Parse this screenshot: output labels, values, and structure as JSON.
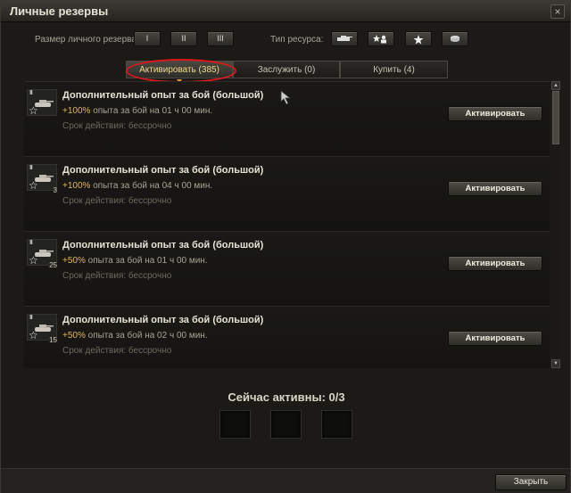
{
  "window": {
    "title": "Личные резервы"
  },
  "filters": {
    "size_label": "Размер личного резерва:",
    "size_buttons": [
      "I",
      "II",
      "III"
    ],
    "type_label": "Тип ресурса:",
    "type_buttons": [
      "tank-xp-icon",
      "crew-xp-icon",
      "free-xp-star-icon",
      "credits-icon"
    ]
  },
  "tabs": [
    {
      "label": "Активировать (385)",
      "active": true
    },
    {
      "label": "Заслужить (0)",
      "active": false
    },
    {
      "label": "Купить (4)",
      "active": false
    }
  ],
  "items": [
    {
      "tier": "III",
      "count": "",
      "name": "Дополнительный опыт за бой (большой)",
      "pct": "+100%",
      "desc": " опыта за бой на 01 ч 00 мин.",
      "duration": "Срок действия: бессрочно",
      "button": "Активировать"
    },
    {
      "tier": "III",
      "count": "3",
      "name": "Дополнительный опыт за бой (большой)",
      "pct": "+100%",
      "desc": " опыта за бой на 04 ч 00 мин.",
      "duration": "Срок действия: бессрочно",
      "button": "Активировать"
    },
    {
      "tier": "III",
      "count": "25",
      "name": "Дополнительный опыт за бой (большой)",
      "pct": "+50%",
      "desc": " опыта за бой на 01 ч 00 мин.",
      "duration": "Срок действия: бессрочно",
      "button": "Активировать"
    },
    {
      "tier": "III",
      "count": "15",
      "name": "Дополнительный опыт за бой (большой)",
      "pct": "+50%",
      "desc": " опыта за бой на 02 ч 00 мин.",
      "duration": "Срок действия: бессрочно",
      "button": "Активировать"
    }
  ],
  "active_section": {
    "title": "Сейчас активны: 0/3"
  },
  "footer": {
    "close_label": "Закрыть"
  },
  "colors": {
    "accent_pct": "#e2b55c",
    "annotation": "#e1161c",
    "active_tab_text": "#f0d98a"
  }
}
